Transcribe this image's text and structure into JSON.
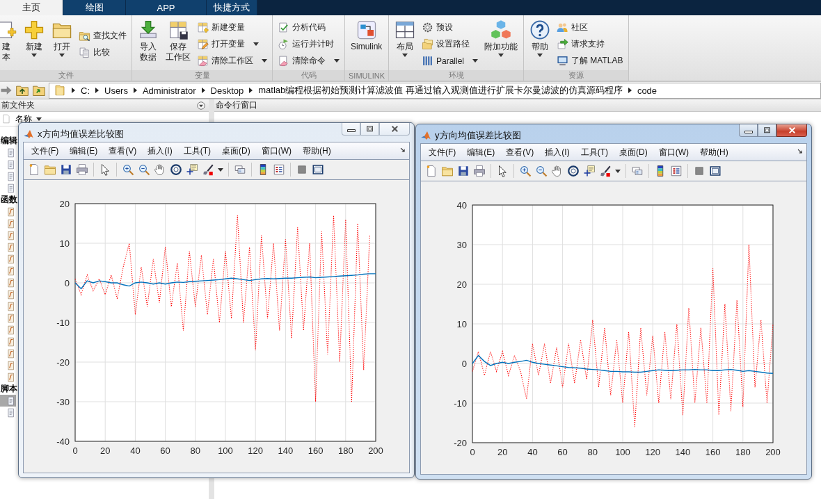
{
  "tabs": [
    {
      "label": "主页",
      "selected": true
    },
    {
      "label": "绘图",
      "selected": false
    },
    {
      "label": "APP",
      "selected": false
    },
    {
      "label": "快捷方式",
      "selected": false
    }
  ],
  "ribbon": {
    "groups": [
      {
        "label": "文件",
        "columns": [
          {
            "kind": "large",
            "items": [
              {
                "lines": [
                  "建",
                  "本"
                ],
                "dropdown": false
              }
            ]
          },
          {
            "kind": "large",
            "items": [
              {
                "lines": [
                  "新建"
                ],
                "dropdown": true
              }
            ]
          },
          {
            "kind": "large",
            "items": [
              {
                "lines": [
                  "打开"
                ],
                "dropdown": true
              }
            ]
          },
          {
            "kind": "small",
            "items": [
              {
                "label": "查找文件",
                "dropdown": false
              },
              {
                "label": "比较",
                "dropdown": false
              }
            ]
          }
        ]
      },
      {
        "label": "变量",
        "columns": [
          {
            "kind": "large",
            "items": [
              {
                "lines": [
                  "导入",
                  "数据"
                ],
                "dropdown": false
              }
            ]
          },
          {
            "kind": "large",
            "items": [
              {
                "lines": [
                  "保存",
                  "工作区"
                ],
                "dropdown": false
              }
            ]
          },
          {
            "kind": "small",
            "items": [
              {
                "label": "新建变量",
                "dropdown": false
              },
              {
                "label": "打开变量",
                "dropdown": true
              },
              {
                "label": "清除工作区",
                "dropdown": true
              }
            ]
          }
        ]
      },
      {
        "label": "代码",
        "columns": [
          {
            "kind": "small",
            "items": [
              {
                "label": "分析代码",
                "dropdown": false
              },
              {
                "label": "运行并计时",
                "dropdown": false
              },
              {
                "label": "清除命令",
                "dropdown": true
              }
            ]
          }
        ]
      },
      {
        "label": "SIMULINK",
        "columns": [
          {
            "kind": "large",
            "items": [
              {
                "lines": [
                  "Simulink"
                ],
                "dropdown": false
              }
            ]
          }
        ]
      },
      {
        "label": "环境",
        "columns": [
          {
            "kind": "large",
            "items": [
              {
                "lines": [
                  "布局"
                ],
                "dropdown": true
              }
            ]
          },
          {
            "kind": "small",
            "items": [
              {
                "label": "预设",
                "dropdown": false
              },
              {
                "label": "设置路径",
                "dropdown": false
              },
              {
                "label": "Parallel",
                "dropdown": true
              }
            ]
          },
          {
            "kind": "large",
            "items": [
              {
                "lines": [
                  "附加功能"
                ],
                "dropdown": true
              }
            ]
          }
        ]
      },
      {
        "label": "资源",
        "columns": [
          {
            "kind": "large",
            "items": [
              {
                "lines": [
                  "帮助"
                ],
                "dropdown": true
              }
            ]
          },
          {
            "kind": "small",
            "items": [
              {
                "label": "社区",
                "dropdown": false
              },
              {
                "label": "请求支持",
                "dropdown": false
              },
              {
                "label": "了解 MATLAB",
                "dropdown": false
              }
            ]
          }
        ]
      }
    ]
  },
  "address_bar": {
    "path": [
      "C:",
      "Users",
      "Administrator",
      "Desktop",
      "matlab编程根据初始预测计算滤波值 再通过输入观测值进行扩展卡尔曼滤波的仿真源码程序",
      "code"
    ]
  },
  "current_folder": {
    "title": "前文件夹",
    "column_header": "名称",
    "sections": [
      {
        "label": "编辑",
        "rows": [
          {
            "selected": false
          },
          {
            "selected": false
          },
          {
            "selected": false
          },
          {
            "selected": false
          }
        ]
      },
      {
        "label": "函数",
        "rows": [
          {
            "selected": false
          },
          {
            "selected": false
          },
          {
            "selected": false
          },
          {
            "selected": false
          },
          {
            "selected": false
          },
          {
            "selected": false
          },
          {
            "selected": false
          },
          {
            "selected": false
          },
          {
            "selected": false
          },
          {
            "selected": false
          },
          {
            "selected": false
          },
          {
            "selected": false
          },
          {
            "selected": false
          },
          {
            "selected": false
          },
          {
            "selected": false
          }
        ]
      },
      {
        "label": "脚本",
        "rows": [
          {
            "selected": true
          },
          {
            "selected": false
          }
        ]
      }
    ]
  },
  "command_window": {
    "title": "命令行窗口"
  },
  "figures": [
    {
      "title": "x方向均值误差比较图",
      "active": false,
      "menu": [
        "文件(F)",
        "编辑(E)",
        "查看(V)",
        "插入(I)",
        "工具(T)",
        "桌面(D)",
        "窗口(W)",
        "帮助(H)"
      ],
      "chart_data": {
        "type": "line",
        "grid": true,
        "xlim": [
          0,
          200
        ],
        "ylim": [
          -40,
          20
        ],
        "xticks": [
          0,
          20,
          40,
          60,
          80,
          100,
          120,
          140,
          160,
          180,
          200
        ],
        "yticks": [
          -40,
          -30,
          -20,
          -10,
          0,
          10,
          20
        ],
        "x": [
          0,
          4,
          8,
          12,
          16,
          20,
          24,
          28,
          32,
          36,
          40,
          44,
          48,
          52,
          56,
          60,
          64,
          68,
          72,
          76,
          80,
          84,
          88,
          92,
          96,
          100,
          104,
          108,
          112,
          116,
          120,
          124,
          128,
          132,
          136,
          140,
          144,
          148,
          152,
          156,
          160,
          164,
          168,
          172,
          176,
          180,
          184,
          188,
          192,
          196,
          200
        ],
        "series": [
          {
            "color": "#ff0000",
            "line_style": "dotted",
            "values": [
              1,
              -3,
              2,
              -2,
              1,
              -3,
              2,
              -4,
              4,
              10,
              -8,
              4,
              -6,
              6,
              -5,
              9,
              -6,
              5,
              -12,
              8,
              -6,
              7,
              -8,
              6,
              -10,
              8,
              -9,
              17,
              -10,
              9,
              -17,
              12,
              -9,
              10,
              -12,
              11,
              -14,
              14,
              -12,
              10,
              -30,
              13,
              -18,
              17,
              -20,
              16,
              -30,
              15,
              -22,
              12,
              null
            ]
          },
          {
            "color": "#0072bd",
            "line_style": "solid",
            "values": [
              0,
              -1.5,
              0.5,
              0,
              0.5,
              0.3,
              0,
              0,
              -0.5,
              -0.8,
              0,
              0.2,
              0,
              -0.3,
              0,
              -0.3,
              0,
              0.2,
              0.1,
              0.3,
              0.4,
              0.5,
              0.6,
              0.7,
              0.8,
              1,
              1.2,
              1,
              0.8,
              0.6,
              0.8,
              1,
              1.1,
              1,
              1.1,
              1.2,
              1.2,
              1.3,
              1.4,
              1.5,
              1.3,
              1.4,
              1.5,
              1.6,
              1.7,
              1.8,
              1.9,
              2,
              2.2,
              2.3,
              2.3
            ]
          }
        ]
      }
    },
    {
      "title": "y方向均值误差比较图",
      "active": true,
      "menu": [
        "文件(F)",
        "编辑(E)",
        "查看(V)",
        "插入(I)",
        "工具(T)",
        "桌面(D)",
        "窗口(W)",
        "帮助(H)"
      ],
      "chart_data": {
        "type": "line",
        "grid": true,
        "xlim": [
          0,
          200
        ],
        "ylim": [
          -20,
          40
        ],
        "xticks": [
          0,
          20,
          40,
          60,
          80,
          100,
          120,
          140,
          160,
          180,
          200
        ],
        "yticks": [
          -20,
          -10,
          0,
          10,
          20,
          30,
          40
        ],
        "x": [
          0,
          4,
          8,
          12,
          16,
          20,
          24,
          28,
          32,
          36,
          40,
          44,
          48,
          52,
          56,
          60,
          64,
          68,
          72,
          76,
          80,
          84,
          88,
          92,
          96,
          100,
          104,
          108,
          112,
          116,
          120,
          124,
          128,
          132,
          136,
          140,
          144,
          148,
          152,
          156,
          160,
          164,
          168,
          172,
          176,
          180,
          184,
          188,
          192,
          196,
          200
        ],
        "series": [
          {
            "color": "#ff0000",
            "line_style": "dotted",
            "values": [
              -2,
              3,
              -3,
              3,
              -2,
              3,
              -3,
              2,
              -2,
              -9,
              5,
              -3,
              5,
              -5,
              4,
              -6,
              5,
              -5,
              6,
              -4,
              11,
              -6,
              9,
              -8,
              6,
              -10,
              8,
              -16,
              9,
              -8,
              7,
              -10,
              8,
              -9,
              10,
              -13,
              14,
              -10,
              9,
              -10,
              24,
              -13,
              15,
              -12,
              16,
              -11,
              30,
              -6,
              11,
              -10,
              10
            ]
          },
          {
            "color": "#0072bd",
            "line_style": "solid",
            "values": [
              0,
              2,
              0.5,
              -0.5,
              0,
              0.3,
              0,
              0.3,
              0.5,
              0.8,
              0.3,
              0,
              -0.2,
              -0.4,
              -0.6,
              -0.8,
              -1,
              -1.1,
              -1.2,
              -1.4,
              -1.5,
              -1.6,
              -1.8,
              -2,
              -2,
              -2.1,
              -2.1,
              -2.2,
              -2.2,
              -2,
              -1.8,
              -1.6,
              -1.7,
              -1.8,
              -1.7,
              -1.6,
              -1.6,
              -1.5,
              -1.6,
              -1.6,
              -1.8,
              -1.8,
              -1.6,
              -1.5,
              -1.7,
              -2,
              -1.8,
              -2,
              -2.2,
              -2.4,
              -2.5
            ]
          }
        ]
      }
    }
  ]
}
